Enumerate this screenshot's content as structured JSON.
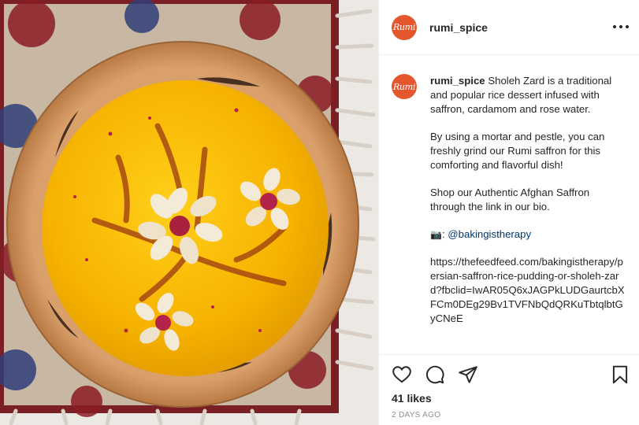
{
  "post": {
    "account": {
      "username": "rumi_spice",
      "avatar_text": "Rumi",
      "brand_color": "#e4572e"
    },
    "photo_alt": "Bowl of saffron rice pudding decorated with cinnamon and almond flowers",
    "caption": {
      "username": "rumi_spice",
      "p1": "Sholeh Zard is a traditional and popular rice dessert infused with saffron, cardamom and rose water.",
      "p2": "By using a mortar and pestle, you can freshly grind our Rumi saffron for this comforting and flavorful dish!",
      "p3": "Shop our Authentic Afghan Saffron through the link in our bio.",
      "credit_icon": "📷",
      "credit_colon": ":",
      "credit_handle": "@bakingistherapy",
      "link": "https://thefeedfeed.com/bakingistherapy/persian-saffron-rice-pudding-or-sholeh-zard?fbclid=IwAR05Q6xJAGPkLUDGaurtcbXFCm0DEg29Bv1TVFNbQdQRKuTbtqlbtGyCNeE"
    },
    "actions": {
      "like_icon": "heart-icon",
      "comment_icon": "comment-icon",
      "share_icon": "paper-plane-icon",
      "save_icon": "bookmark-icon"
    },
    "likes": "41 likes",
    "timestamp": "2 DAYS AGO"
  }
}
